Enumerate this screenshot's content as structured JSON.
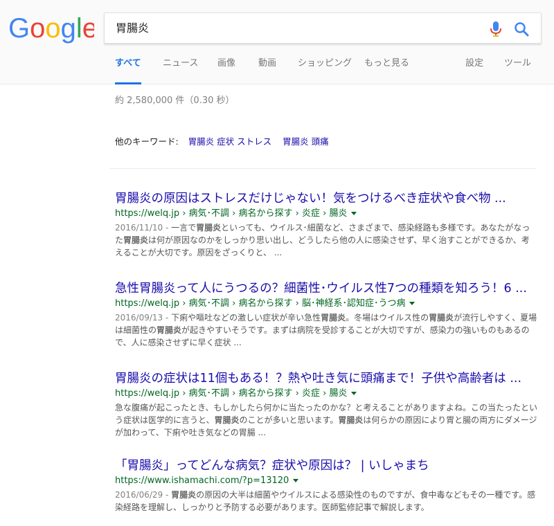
{
  "logo": {
    "text": "Google"
  },
  "search": {
    "query": "胃腸炎"
  },
  "tabs": [
    {
      "label": "すべて",
      "active": true
    },
    {
      "label": "ニュース"
    },
    {
      "label": "画像"
    },
    {
      "label": "動画"
    },
    {
      "label": "ショッピング"
    },
    {
      "label": "もっと見る"
    },
    {
      "label": "設定"
    },
    {
      "label": "ツール"
    }
  ],
  "stats": "約 2,580,000 件（0.30 秒）",
  "keywords": {
    "label": "他のキーワード:",
    "items": [
      "胃腸炎 症状 ストレス",
      "胃腸炎 頭痛"
    ]
  },
  "results": [
    {
      "title": "胃腸炎の原因はストレスだけじゃない！気をつけるべき症状や食べ物 ...",
      "url": "https://welq.jp › 病気･不調 › 病名から探す › 炎症 › 腸炎",
      "date": "2016/11/10 - ",
      "snippet": "一言で<b>胃腸炎</b>といっても、ウイルス･細菌など、さまざまで、感染経路も多様です。あなたがなった<b>胃腸炎</b>は何が原因なのかをしっかり思い出し、どうしたら他の人に感染させず、早く治すことができるか、考えることが大切です。原因をざっくりと、 ..."
    },
    {
      "title": "急性胃腸炎って人にうつるの？細菌性･ウイルス性7つの種類を知ろう！6 ...",
      "url": "https://welq.jp › 病気･不調 › 病名から探す › 脳･神経系･認知症･うつ病",
      "date": "2016/09/13 - ",
      "snippet": "下痢や嘔吐などの激しい症状が辛い急性<b>胃腸炎</b>。冬場はウイルス性の<b>胃腸炎</b>が流行しやすく、夏場は細菌性の<b>胃腸炎</b>が起きやすいそうです。まずは病院を受診することが大切ですが、感染力の強いものもあるので、人に感染させずに早く症状 ..."
    },
    {
      "title": "胃腸炎の症状は11個もある！？熱や吐き気に頭痛まで！子供や高齢者は ...",
      "url": "https://welq.jp › 病気･不調 › 病名から探す › 炎症 › 腸炎",
      "date": "",
      "snippet": "急な腹痛が起こったとき、もしかしたら何かに当たったのかな？と考えることがありますよね。この当たったという症状は医学的に言うと、<b>胃腸炎</b>のことが多いと思います。<b>胃腸炎</b>は何らかの原因により胃と腸の両方にダメージが加わって、下痢や吐き気などの胃腸 ..."
    },
    {
      "title": "「胃腸炎」ってどんな病気？症状や原因は？ | いしゃまち",
      "url": "https://www.ishamachi.com/?p=13120",
      "date": "2016/06/29 - ",
      "snippet": "<b>胃腸炎</b>の原因の大半は細菌やウイルスによる感染性のものですが、食中毒などもその一種です。感染経路を理解し、しっかりと予防する必要があります。医師監修記事で解説します。"
    }
  ],
  "colors": {
    "link": "#1a0dab",
    "url": "#006621",
    "accent": "#1a73e8"
  }
}
